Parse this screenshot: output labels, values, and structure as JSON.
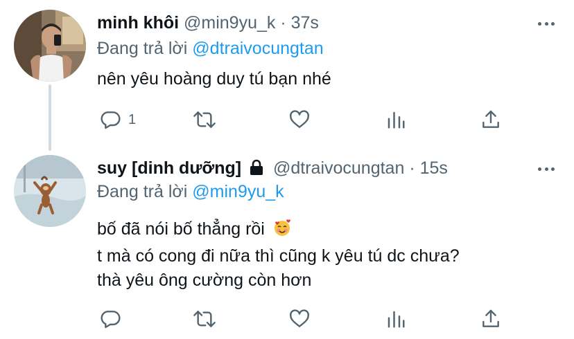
{
  "tweets": [
    {
      "author_name": "minh khôi",
      "handle": "@min9yu_k",
      "separator": "·",
      "time": "37s",
      "replying_prefix": "Đang trả lời",
      "replying_to": "@dtraivocungtan",
      "lines": [
        "nên yêu hoàng duy tú bạn nhé"
      ],
      "reply_count": "1",
      "locked": false
    },
    {
      "author_name": "suy [dinh dưỡng]",
      "handle": "@dtraivocungtan",
      "separator": "·",
      "time": "15s",
      "replying_prefix": "Đang trả lời",
      "replying_to": "@min9yu_k",
      "lines": [
        "bố đã nói bố thẳng rồi",
        "t mà có cong đi nữa thì cũng k yêu tú dc chưa?",
        "thà yêu ông cường còn hơn"
      ],
      "reply_count": "",
      "locked": true
    }
  ],
  "colors": {
    "text": "#0f1419",
    "secondary": "#536471",
    "link": "#1d9bf0",
    "thread_line": "#cfd9de"
  },
  "icons": {
    "more": "more-horizontal-icon",
    "reply": "reply-bubble-icon",
    "retweet": "retweet-icon",
    "like": "heart-icon",
    "views": "analytics-bars-icon",
    "share": "share-upload-icon",
    "lock": "lock-icon",
    "emoji": "smiling-face-with-hearts-icon"
  }
}
